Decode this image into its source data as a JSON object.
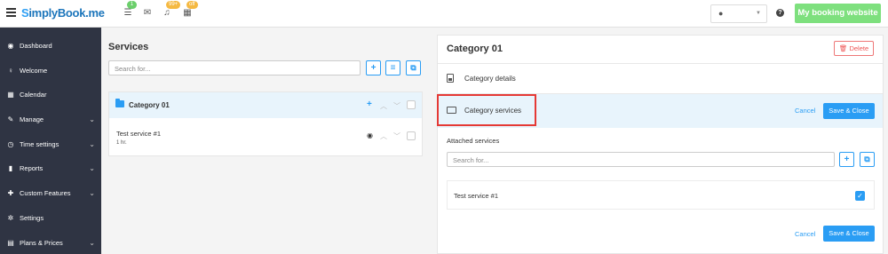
{
  "topbar": {
    "logo_prefix": "S",
    "logo_main": "implyBook",
    "logo_suffix": ".me",
    "badges": [
      "1",
      "99+",
      "off"
    ],
    "help": "?",
    "booking_button": "My booking website"
  },
  "sidebar": {
    "items": [
      {
        "label": "Dashboard",
        "icon": "dashboard-icon",
        "chevron": false
      },
      {
        "label": "Welcome",
        "icon": "lightbulb-icon",
        "chevron": false
      },
      {
        "label": "Calendar",
        "icon": "calendar-icon",
        "chevron": false
      },
      {
        "label": "Manage",
        "icon": "pencil-icon",
        "chevron": true
      },
      {
        "label": "Time settings",
        "icon": "clock-icon",
        "chevron": true
      },
      {
        "label": "Reports",
        "icon": "bar-chart-icon",
        "chevron": true
      },
      {
        "label": "Custom Features",
        "icon": "puzzle-icon",
        "chevron": true
      },
      {
        "label": "Settings",
        "icon": "gears-icon",
        "chevron": false
      },
      {
        "label": "Plans & Prices",
        "icon": "cart-icon",
        "chevron": true
      }
    ]
  },
  "services": {
    "title": "Services",
    "search_placeholder": "Search for...",
    "category": "Category 01",
    "service_name": "Test service #1",
    "service_duration": "1 hr."
  },
  "panel": {
    "title": "Category 01",
    "delete_label": "Delete",
    "details_label": "Category details",
    "services_label": "Category services",
    "cancel_label": "Cancel",
    "save_label": "Save & Close",
    "attached_label": "Attached services",
    "search_placeholder": "Search for...",
    "attached_item": "Test service #1"
  },
  "colors": {
    "accent": "#2a9df4",
    "booking": "#7ee07e",
    "sidebar": "#2f3443",
    "highlight": "#e53935"
  }
}
